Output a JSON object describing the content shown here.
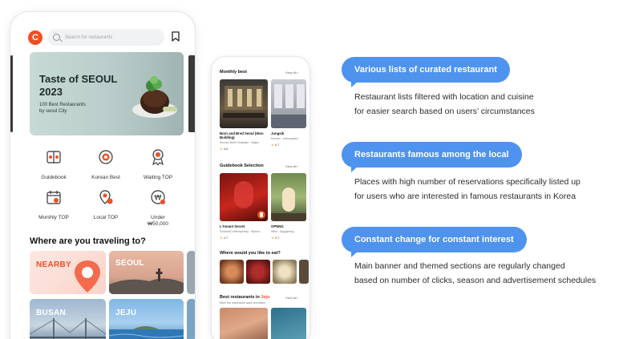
{
  "big_phone": {
    "logo_letter": "C",
    "search_placeholder": "Search for restaurants",
    "banner": {
      "title_line1": "Taste of SEOUL",
      "title_line2": "2023",
      "subtitle_line1": "100 Best Restaurants",
      "subtitle_line2": "by seoul City"
    },
    "categories": [
      {
        "label": "Guidebook",
        "icon": "guidebook-icon"
      },
      {
        "label": "Korean Best",
        "icon": "korean-best-icon"
      },
      {
        "label": "Waiting TOP",
        "icon": "waiting-top-icon"
      },
      {
        "label": "Monthly TOP",
        "icon": "monthly-top-icon"
      },
      {
        "label": "Local TOP",
        "icon": "local-top-icon"
      },
      {
        "label_line1": "Under",
        "label_line2": "₩50,000",
        "icon": "under-price-icon"
      }
    ],
    "section_title": "Where are you traveling to?",
    "destinations": [
      "NEARBY",
      "SEOUL",
      "BUSAN",
      "JEJU"
    ]
  },
  "small_phone": {
    "monthly_best": {
      "title": "Monthly best",
      "view_all": "View All",
      "items": [
        {
          "name_line1": "Born and Bred Seoul (Won",
          "name_line2": "Building)",
          "sub": "Korean Beef Omakase · Mape...",
          "rating": "4.6"
        },
        {
          "name_line1": "Jungsik",
          "name_line2": "",
          "sub": "Korean · cheongdam",
          "rating": "4.7"
        }
      ]
    },
    "guidebook": {
      "title": "Guidebook Selection",
      "view_all": "View All",
      "items": [
        {
          "name": "L'Amant Secret",
          "sub": "Fusion&Contemporary · Myeon...",
          "rating": "4.7"
        },
        {
          "name": "OPNNG",
          "sub": "Wine · Apgujeong",
          "rating": "4.7"
        }
      ]
    },
    "where_title": "Where would you like to eat?",
    "jeju_section": {
      "title_prefix": "Best restaurants in",
      "title_city": "Jeju",
      "subtitle": "Meet the impressive auto recreation",
      "view_all": "View All"
    }
  },
  "features": [
    {
      "heading": "Various lists of curated restaurant",
      "line1": "Restaurant lists filtered with location and cuisine",
      "line2": "for easier search based on users’ circumstances"
    },
    {
      "heading": "Restaurants famous among the local",
      "line1": "Places with high number of reservations specifically listed up",
      "line2": "for users who are interested in famous restaurants in Korea"
    },
    {
      "heading": "Constant change for constant interest",
      "line1": "Main banner and themed sections are regularly changed",
      "line2": "based on number of clicks, season and advertisement schedules"
    }
  ],
  "colors": {
    "brand": "#f04e23",
    "accent_blue": "#4e93ee"
  }
}
